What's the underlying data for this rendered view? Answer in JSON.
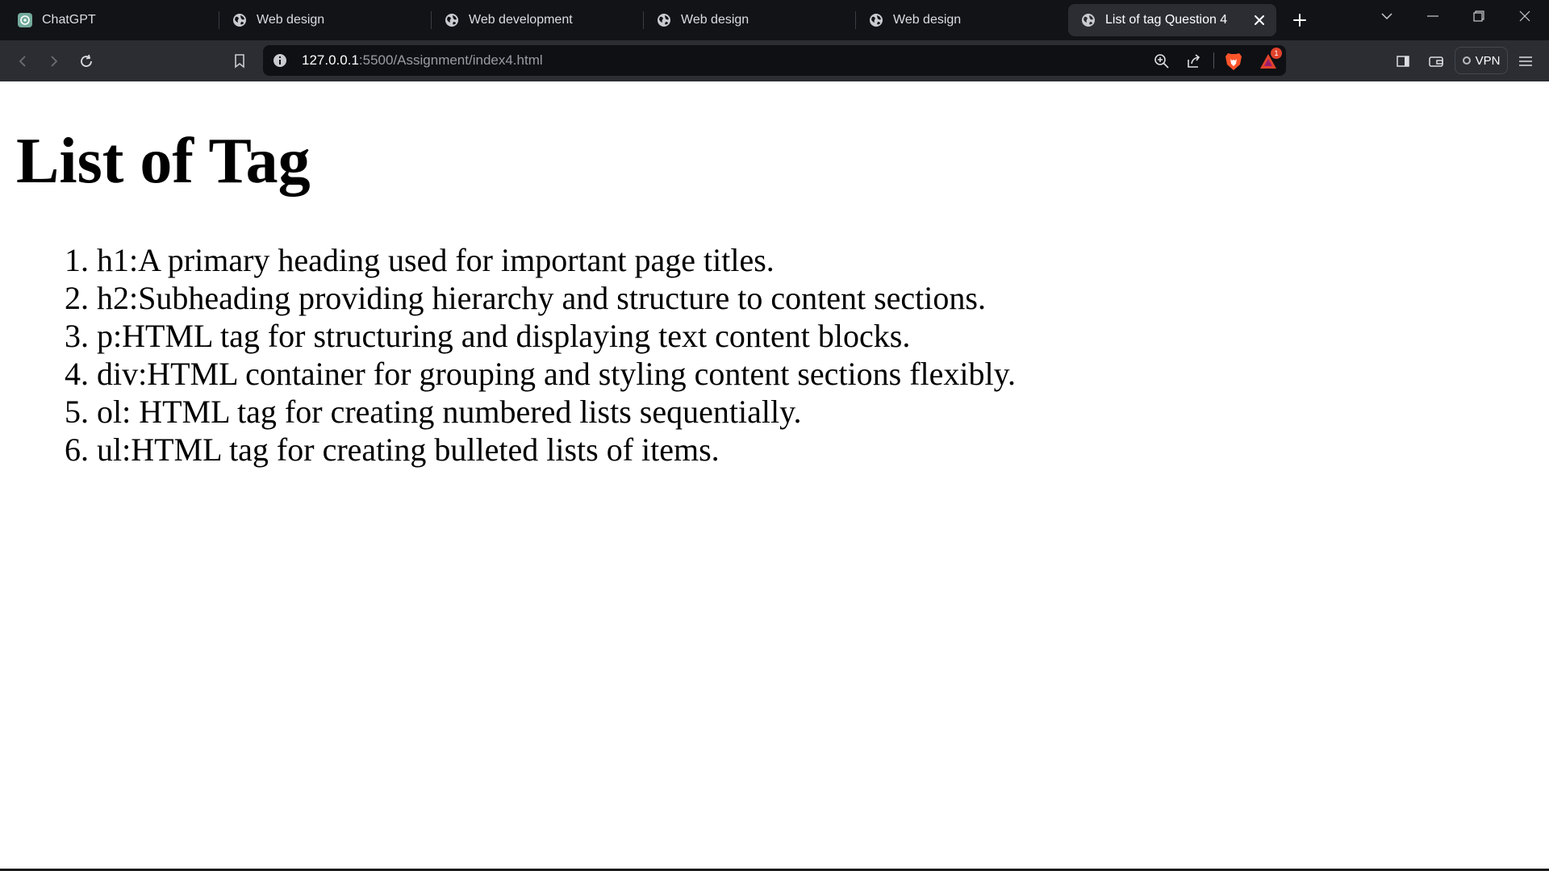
{
  "browser": {
    "tabs": [
      {
        "label": "ChatGPT",
        "icon": "chatgpt-icon"
      },
      {
        "label": "Web design",
        "icon": "globe-icon"
      },
      {
        "label": "Web development",
        "icon": "globe-icon"
      },
      {
        "label": "Web design",
        "icon": "globe-icon"
      },
      {
        "label": "Web design",
        "icon": "globe-icon"
      },
      {
        "label": "List of tag Question 4",
        "icon": "globe-icon",
        "active": true
      }
    ],
    "address": {
      "host": "127.0.0.1",
      "rest": ":5500/Assignment/index4.html"
    },
    "rewards_badge_count": "1",
    "vpn_label": "VPN",
    "colors": {
      "tabstrip_bg": "#121317",
      "toolbar_bg": "#2b2d33",
      "omnibox_bg": "#0f1014",
      "brave_orange": "#fb542b",
      "badge_red": "#e2422c"
    }
  },
  "page": {
    "title": "List of Tag",
    "items": [
      "h1:A primary heading used for important page titles.",
      "h2:Subheading providing hierarchy and structure to content sections.",
      "p:HTML tag for structuring and displaying text content blocks.",
      "div:HTML container for grouping and styling content sections flexibly.",
      "ol: HTML tag for creating numbered lists sequentially.",
      "ul:HTML tag for creating bulleted lists of items."
    ]
  }
}
